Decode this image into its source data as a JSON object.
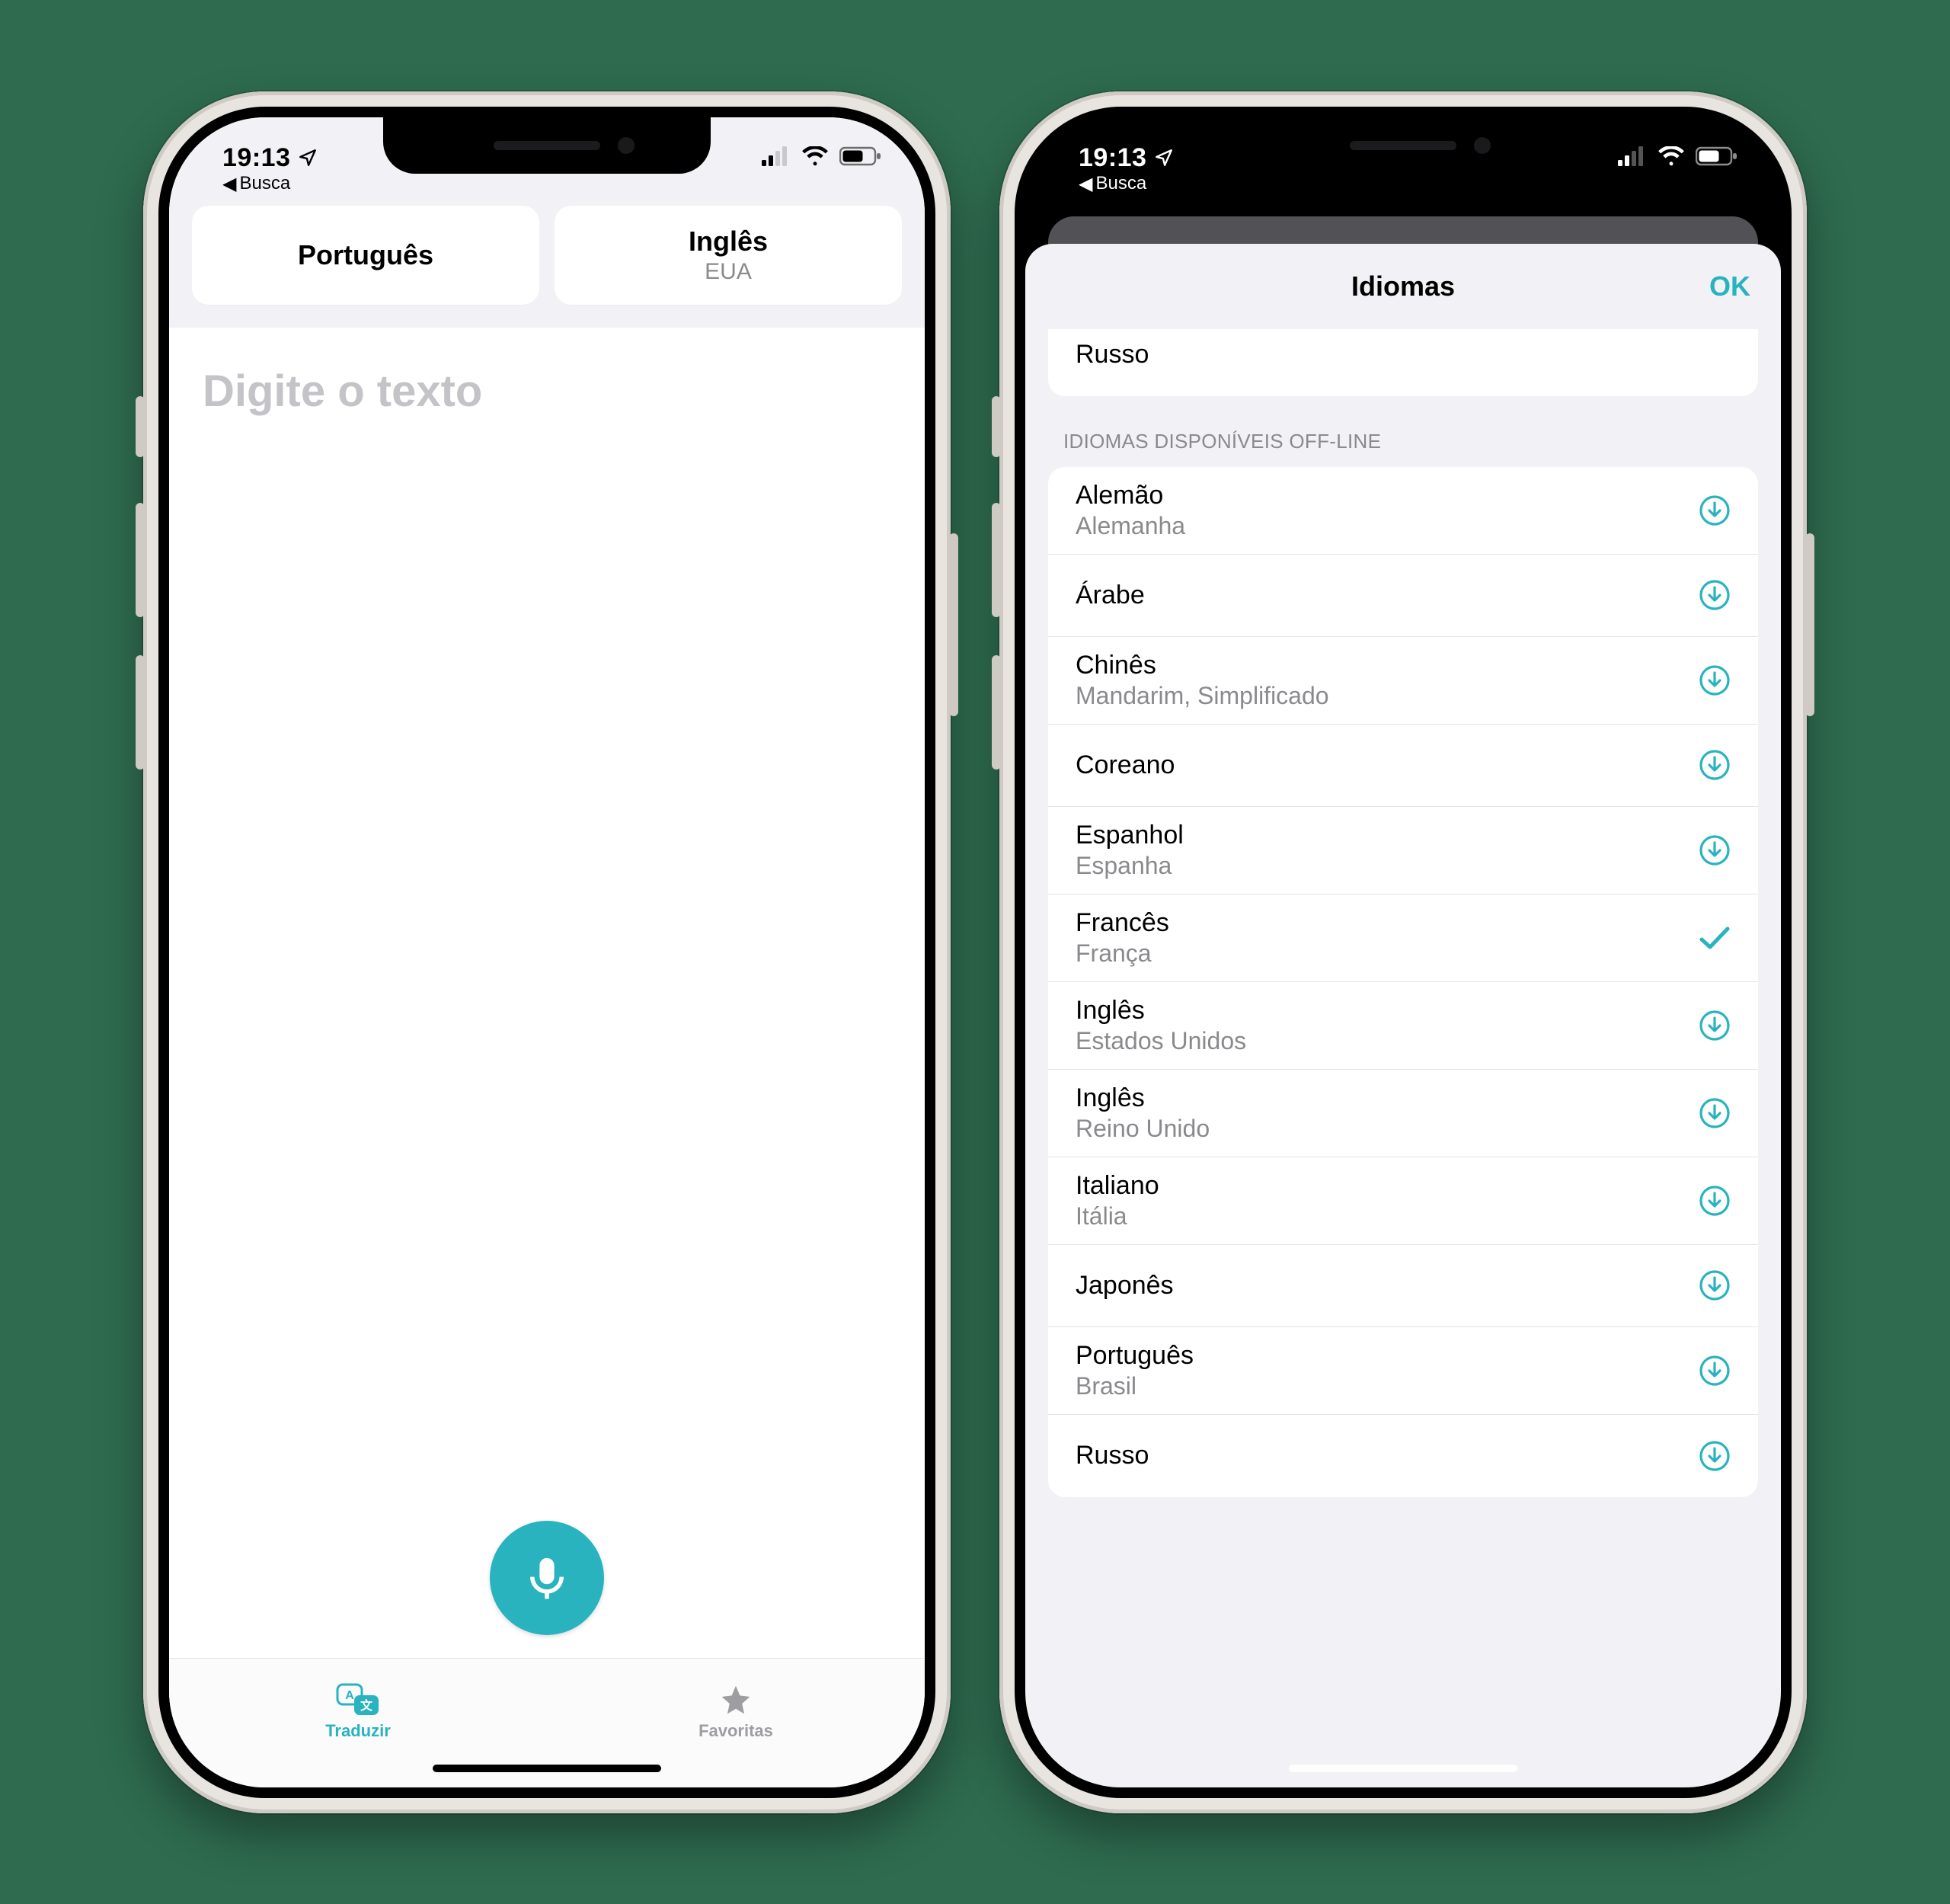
{
  "status": {
    "clock": "19:13",
    "back_label": "Busca"
  },
  "phone1": {
    "lang_src": {
      "primary": "Português",
      "secondary": ""
    },
    "lang_dst": {
      "primary": "Inglês",
      "secondary": "EUA"
    },
    "input_placeholder": "Digite o texto",
    "tabs": {
      "translate": "Traduzir",
      "favorites": "Favoritas"
    }
  },
  "phone2": {
    "sheet_title": "Idiomas",
    "ok_label": "OK",
    "top_row": "Russo",
    "section_header": "IDIOMAS DISPONÍVEIS OFF-LINE",
    "languages": [
      {
        "name": "Alemão",
        "sub": "Alemanha",
        "state": "download"
      },
      {
        "name": "Árabe",
        "sub": "",
        "state": "download"
      },
      {
        "name": "Chinês",
        "sub": "Mandarim, Simplificado",
        "state": "download"
      },
      {
        "name": "Coreano",
        "sub": "",
        "state": "download"
      },
      {
        "name": "Espanhol",
        "sub": "Espanha",
        "state": "download"
      },
      {
        "name": "Francês",
        "sub": "França",
        "state": "selected"
      },
      {
        "name": "Inglês",
        "sub": "Estados Unidos",
        "state": "download"
      },
      {
        "name": "Inglês",
        "sub": "Reino Unido",
        "state": "download"
      },
      {
        "name": "Italiano",
        "sub": "Itália",
        "state": "download"
      },
      {
        "name": "Japonês",
        "sub": "",
        "state": "download"
      },
      {
        "name": "Português",
        "sub": "Brasil",
        "state": "download"
      },
      {
        "name": "Russo",
        "sub": "",
        "state": "download"
      }
    ]
  }
}
